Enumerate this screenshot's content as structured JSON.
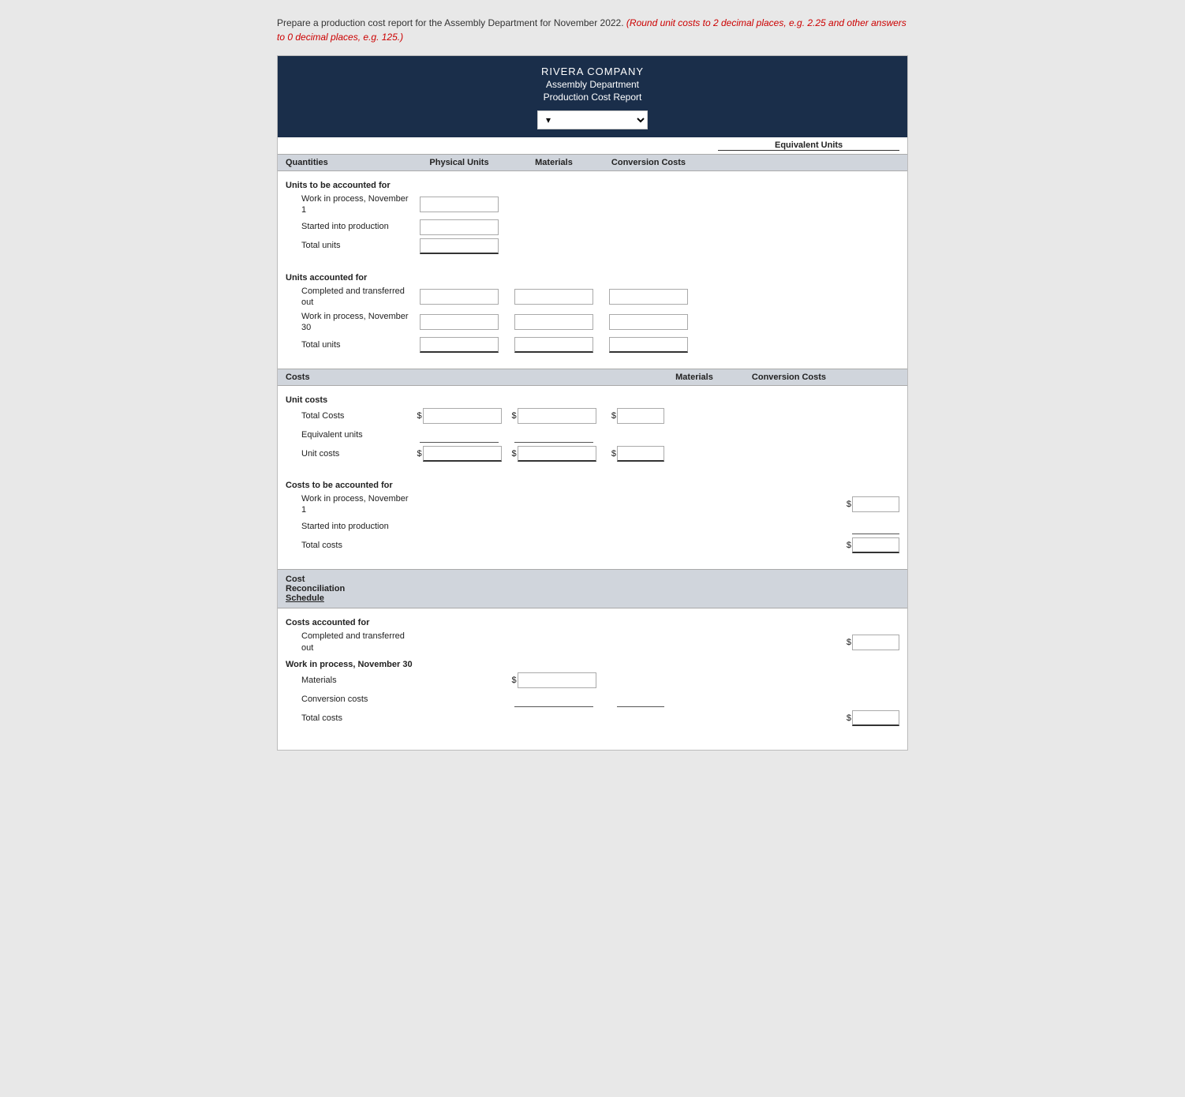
{
  "instructions": {
    "main": "Prepare a production cost report for the Assembly Department for November 2022.",
    "highlight": "(Round unit costs to 2 decimal places, e.g. 2.25 and other answers to 0 decimal places, e.g. 125.)"
  },
  "header": {
    "company": "RIVERA COMPANY",
    "department": "Assembly Department",
    "report_title": "Production Cost Report",
    "dropdown_placeholder": "▾"
  },
  "quantities_section": {
    "col_quantities": "Quantities",
    "col_physical": "Physical Units",
    "col_equiv": "Equivalent Units",
    "col_materials": "Materials",
    "col_conversion": "Conversion Costs",
    "units_to_account_label": "Units to be accounted for",
    "wip_nov1_label": "Work in process, November 1",
    "started_production_label": "Started into production",
    "total_units_label": "Total units",
    "units_accounted_label": "Units accounted for",
    "completed_transferred_label": "Completed and transferred out",
    "wip_nov30_label": "Work in process, November 30",
    "total_units2_label": "Total units"
  },
  "costs_section": {
    "col_costs": "Costs",
    "col_materials": "Materials",
    "col_conversion": "Conversion Costs",
    "unit_costs_label": "Unit costs",
    "total_costs_label": "Total Costs",
    "equiv_units_label": "Equivalent units",
    "unit_costs2_label": "Unit costs",
    "costs_to_account_label": "Costs to be accounted for",
    "wip_nov1_label": "Work in process, November 1",
    "started_prod_label": "Started into production",
    "total_costs2_label": "Total costs"
  },
  "reconciliation_section": {
    "header_line1": "Cost",
    "header_line2": "Reconciliation",
    "header_line3": "Schedule",
    "costs_accounted_label": "Costs accounted for",
    "completed_transferred_label": "Completed and transferred out",
    "wip_nov30_label": "Work in process, November 30",
    "materials_label": "Materials",
    "conversion_costs_label": "Conversion costs",
    "total_costs_label": "Total costs"
  }
}
